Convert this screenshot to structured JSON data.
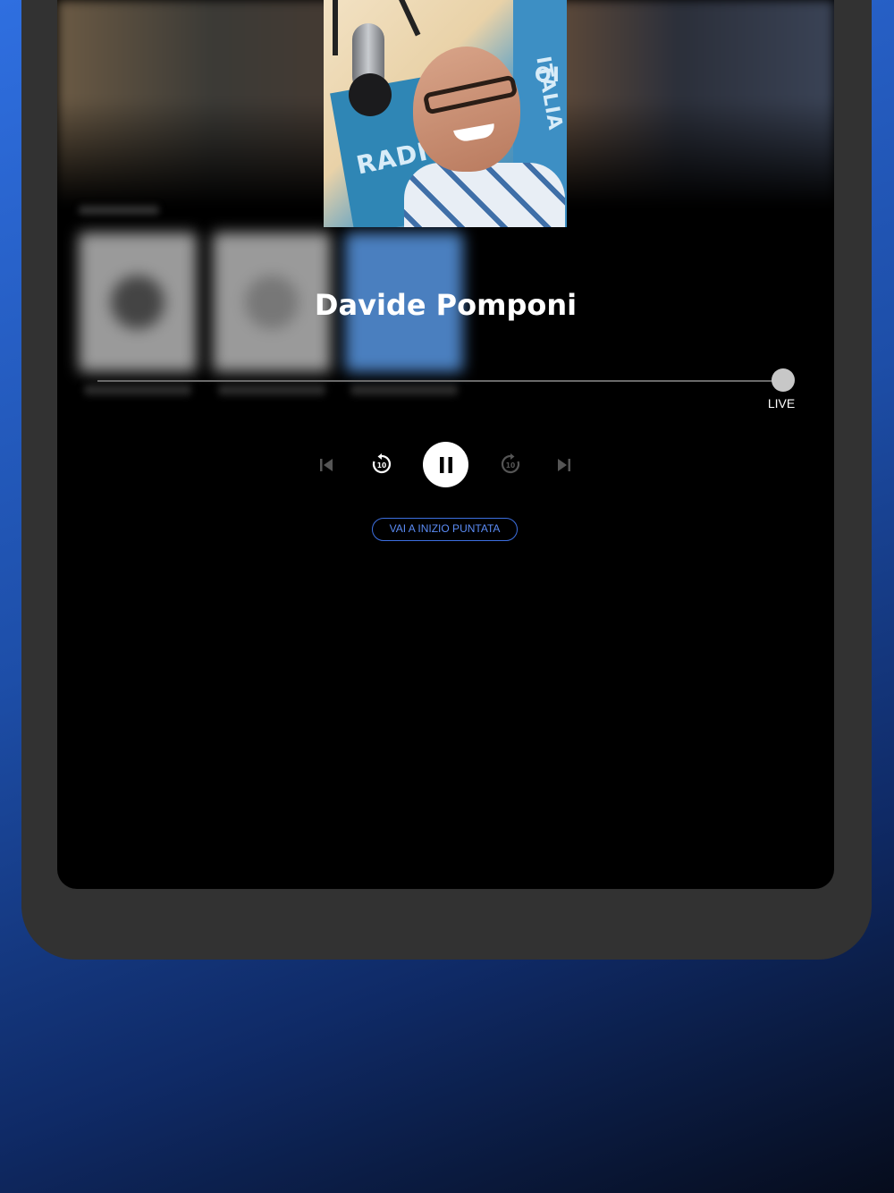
{
  "player": {
    "title": "Davide Pomponi",
    "live_label": "LIVE",
    "jump_button_label": "VAI A INIZIO PUNTATA",
    "progress": 1.0,
    "rewind_seconds": "10",
    "forward_seconds": "10"
  },
  "cover": {
    "text_lines": [
      "RADIO",
      "ITALIA",
      "OI"
    ]
  },
  "icons": {
    "previous": "skip-previous-icon",
    "rewind": "rewind-10-icon",
    "pause": "pause-icon",
    "forward": "forward-10-icon",
    "next": "skip-next-icon"
  },
  "colors": {
    "accent": "#3d6fe0",
    "background": "#000000",
    "device_frame": "#323232"
  }
}
